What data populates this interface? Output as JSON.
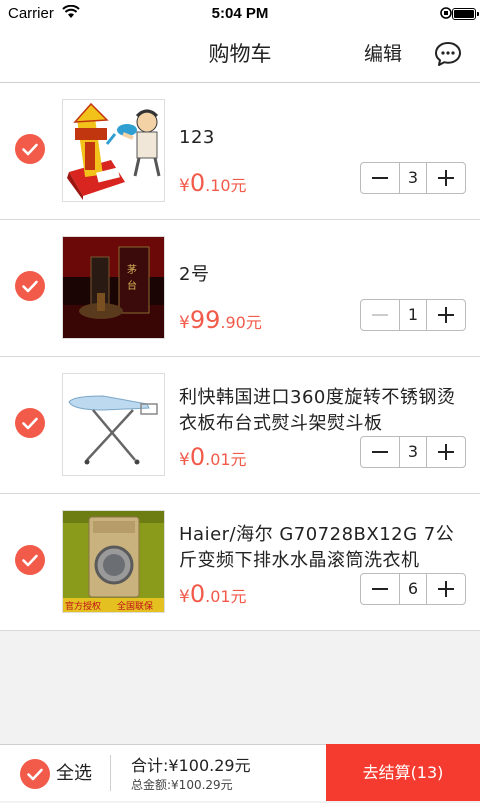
{
  "status_bar": {
    "carrier": "Carrier",
    "time": "5:04 PM"
  },
  "nav": {
    "title": "购物车",
    "edit_label": "编辑",
    "message_icon": "chat-bubble-icon"
  },
  "colors": {
    "accent": "#f25a4a",
    "checkout_bg": "#f53b2f"
  },
  "items": [
    {
      "name": "123",
      "price_symbol": "¥",
      "price_int": "0",
      "price_dec": ".10元",
      "quantity": "3",
      "selected": true
    },
    {
      "name": "2号",
      "price_symbol": "¥",
      "price_int": "99",
      "price_dec": ".90元",
      "quantity": "1",
      "selected": true
    },
    {
      "name": "利快韩国进口360度旋转不锈钢烫衣板布台式熨斗架熨斗板",
      "price_symbol": "¥",
      "price_int": "0",
      "price_dec": ".01元",
      "quantity": "3",
      "selected": true
    },
    {
      "name": "Haier/海尔 G70728BX12G 7公斤变频下排水水晶滚筒洗衣机",
      "price_symbol": "¥",
      "price_int": "0",
      "price_dec": ".01元",
      "quantity": "6",
      "selected": true,
      "image_banner": [
        "官方授权",
        "全国联保"
      ]
    }
  ],
  "bottom": {
    "select_all_label": "全选",
    "total_label": "合计:",
    "total_value": "¥100.29元",
    "grand_label": "总金额:",
    "grand_value": "¥100.29元",
    "checkout_label": "去结算(13)"
  }
}
